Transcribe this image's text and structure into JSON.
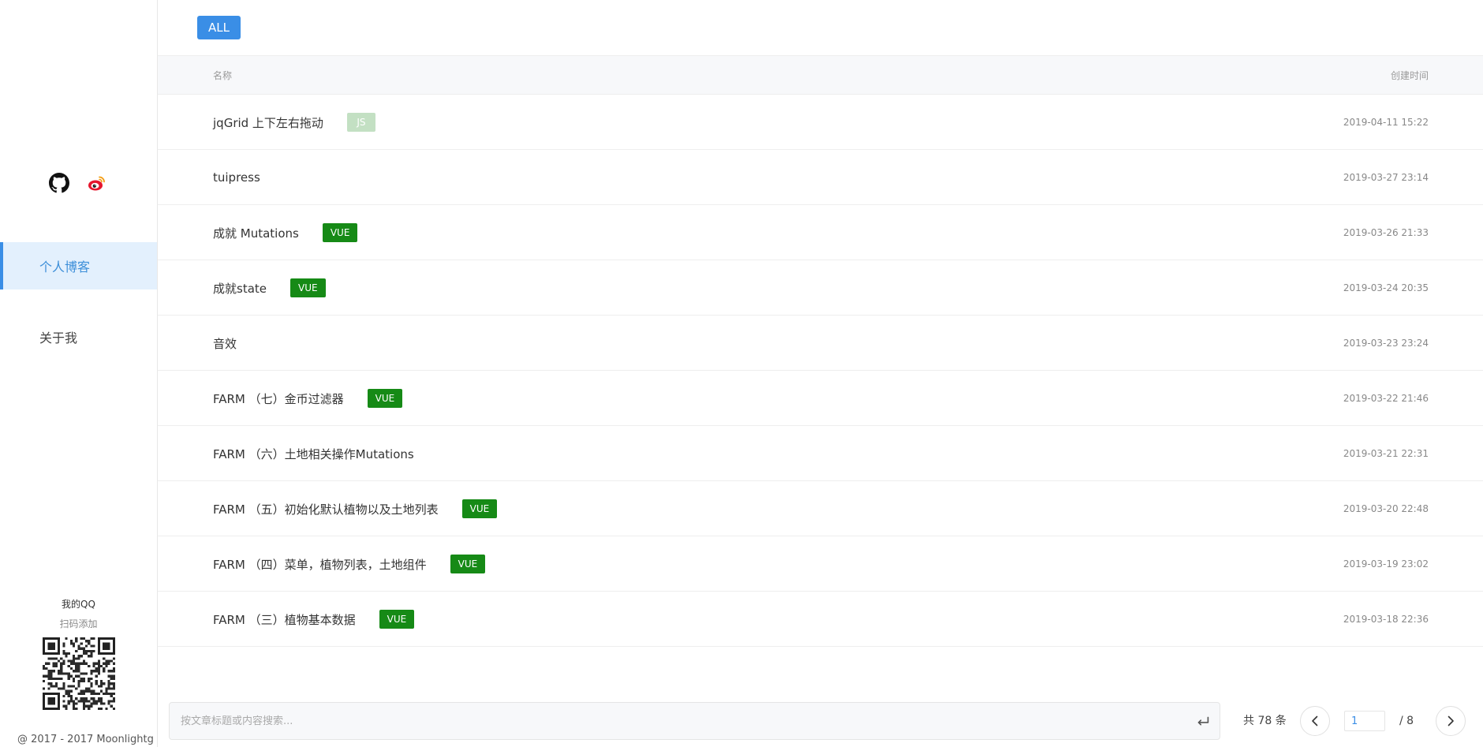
{
  "sidebar": {
    "social_icons": [
      "github-icon",
      "weibo-icon"
    ],
    "nav": [
      {
        "label": "个人博客",
        "active": true
      },
      {
        "label": "关于我",
        "active": false
      }
    ],
    "qq_title": "我的QQ",
    "qq_subtitle": "扫码添加",
    "copyright": "@ 2017 - 2017 Moonlightg"
  },
  "filter": {
    "all_label": "ALL"
  },
  "table": {
    "header_name": "名称",
    "header_date": "创建时间",
    "rows": [
      {
        "title": "jqGrid 上下左右拖动",
        "tag": "JS",
        "tag_color": "#c3e0c3",
        "date": "2019-04-11 15:22"
      },
      {
        "title": "tuipress",
        "tag": "",
        "tag_color": "",
        "date": "2019-03-27 23:14"
      },
      {
        "title": "成就 Mutations",
        "tag": "VUE",
        "tag_color": "#168a16",
        "date": "2019-03-26 21:33"
      },
      {
        "title": "成就state",
        "tag": "VUE",
        "tag_color": "#168a16",
        "date": "2019-03-24 20:35"
      },
      {
        "title": "音效",
        "tag": "",
        "tag_color": "",
        "date": "2019-03-23 23:24"
      },
      {
        "title": "FARM （七）金币过滤器",
        "tag": "VUE",
        "tag_color": "#168a16",
        "date": "2019-03-22 21:46"
      },
      {
        "title": "FARM （六）土地相关操作Mutations",
        "tag": "",
        "tag_color": "",
        "date": "2019-03-21 22:31"
      },
      {
        "title": "FARM （五）初始化默认植物以及土地列表",
        "tag": "VUE",
        "tag_color": "#168a16",
        "date": "2019-03-20 22:48"
      },
      {
        "title": "FARM （四）菜单，植物列表，土地组件",
        "tag": "VUE",
        "tag_color": "#168a16",
        "date": "2019-03-19 23:02"
      },
      {
        "title": "FARM （三）植物基本数据",
        "tag": "VUE",
        "tag_color": "#168a16",
        "date": "2019-03-18 22:36"
      }
    ]
  },
  "search": {
    "placeholder": "按文章标题或内容搜索...",
    "value": ""
  },
  "pagination": {
    "total_text": "共 78 条",
    "current_page": "1",
    "total_pages_text": "/ 8"
  },
  "colors": {
    "accent": "#3a8ee6",
    "tag_vue": "#168a16",
    "tag_js": "#c3e0c3"
  }
}
